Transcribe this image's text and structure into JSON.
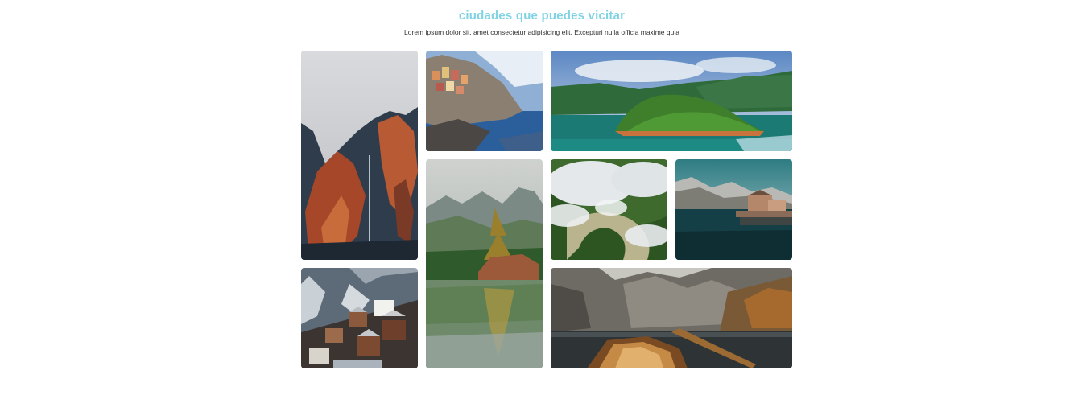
{
  "header": {
    "title": "ciudades que puedes vicitar",
    "subtitle": "Lorem ipsum dolor sit, amet consectetur adipisicing elit. Excepturi nulla officia maxime quia"
  },
  "gallery": {
    "photos": [
      {
        "name": "photo-misty-cliffs-waterfall"
      },
      {
        "name": "photo-coastal-village"
      },
      {
        "name": "photo-green-lake-island"
      },
      {
        "name": "photo-mountain-lake-tree-reflection"
      },
      {
        "name": "photo-aerial-cloud-forest"
      },
      {
        "name": "photo-lake-village-mountains"
      },
      {
        "name": "photo-alpine-village"
      },
      {
        "name": "photo-boat-mountain-lake"
      }
    ]
  }
}
